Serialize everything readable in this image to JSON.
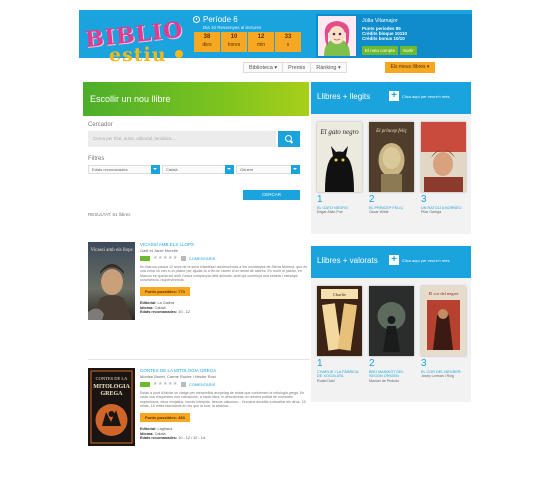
{
  "header": {
    "logo_top": "BIBLIO",
    "logo_bottom": "estiu",
    "period_title": "Període 6",
    "period_sub": "Dia 10 Ressenyes al lectures",
    "countdown": [
      {
        "num": "38",
        "unit": "dies"
      },
      {
        "num": "10",
        "unit": "hores"
      },
      {
        "num": "12",
        "unit": "min"
      },
      {
        "num": "33",
        "unit": "s"
      }
    ]
  },
  "user": {
    "name": "Júlia Vilamajor",
    "stats": [
      "Punts periodes 85",
      "Crèdits bloque 10110",
      "Crèdits bonus 10/10"
    ],
    "btn_account": "El meu compte",
    "btn_exit": "Sortir"
  },
  "nav": {
    "items": [
      "Biblioteca ▾",
      "Premis",
      "Rànking ▾"
    ],
    "cta": "Els meus llibres ▾"
  },
  "main": {
    "choose_title": "Escollir un nou llibre",
    "search_label": "Cercador",
    "search_placeholder": "Cerca per títol, autor, editorial, temàtica ...",
    "filters_label": "Filtres",
    "filter_ages": "Edats recomanades",
    "filter_lang": "Català",
    "filter_genre": "Gènere",
    "search_button": "CERCAR",
    "results": "RESULTAT: 61 llibres"
  },
  "books": [
    {
      "title": "VICASSÍ AMB ELS LLOPS",
      "author": "Gaël et Janie Morelle",
      "comments": "COMENTARIS",
      "description": "En Maroco passa 12 anys de la seva infantesa i adolescència a les muntanyes de Sierra Morena, que és una zona on van a un pastor per ajudar-lo a fer-se càrrec d'un ramat de cabres. En morir el pastor, en Marcos es queda sol amb l'única companyia dels animals, amb qui comença una estreta i estranya convivència i supervivència.",
      "points": "Punts possibles: 773",
      "editorial_label": "Editorial:",
      "editorial": "La Galera",
      "language_label": "Idioma:",
      "language": "Català",
      "ages_label": "Edats recomanades:",
      "ages": "10 - 12",
      "cover_title": "Vicassí amb els llops"
    },
    {
      "title": "CONTES DE LA MITOLOGIA GREGA",
      "author": "Montse Bonet, Carme Roche i Hèctor Rosi",
      "comments": "COMENTARIS",
      "description": "Estàs a punt d'iniciar un viatge per meravellós arxipèlag de relats que conformen la mitologia grega. En cada una d'aquestes nou narracions, a cada mica, hi descobriràs un univers poblat de monstres espantosos, déus venjatius, herois intrèpids, tresors valuosos... Humans decidits a desafiar els déus. 15 relats, 15 mites fascinants en els que la sort, la saviesa...",
      "points": "Punts possibles: 483",
      "editorial_label": "Editorial:",
      "editorial": "Laghana",
      "language_label": "Idioma:",
      "language": "Català",
      "ages_label": "Edats recomanades:",
      "ages": "10 - 12 / 12 - 14",
      "cover_title": "CONTES DE LA MITOLOGIA GREGA"
    }
  ],
  "rankings": [
    {
      "title": "Llibres + llegits",
      "see_more": "Clica aquí per veure'n més",
      "items": [
        {
          "rank": "1",
          "title": "EL GATO NEGRO",
          "author": "Edgar Allan Poe",
          "cover_text": "El gato negro"
        },
        {
          "rank": "2",
          "title": "EL PRÍNCEP FELIÇ",
          "author": "Oscar Wilde",
          "cover_text": "El príncep feliç"
        },
        {
          "rank": "3",
          "title": "UN RATOLÍ A BORNEO",
          "author": "Pilar Garriga",
          "cover_text": ""
        }
      ]
    },
    {
      "title": "Llibres + valorats",
      "see_more": "Clica aquí per veure'n més",
      "items": [
        {
          "rank": "1",
          "title": "CHARLIE I LA FÀBRICA DE XOCOLATA",
          "author": "Roald Dahl",
          "cover_text": "Charlie"
        },
        {
          "rank": "2",
          "title": "BRÜ MANIKÓT DEL SEGON ORIGEN",
          "author": "Manuel de Pedrolo",
          "cover_text": ""
        },
        {
          "rank": "3",
          "title": "EL COR DEL NEGRER",
          "author": "Josep Lorman i Roig",
          "cover_text": "El cor del negrer"
        }
      ]
    }
  ]
}
